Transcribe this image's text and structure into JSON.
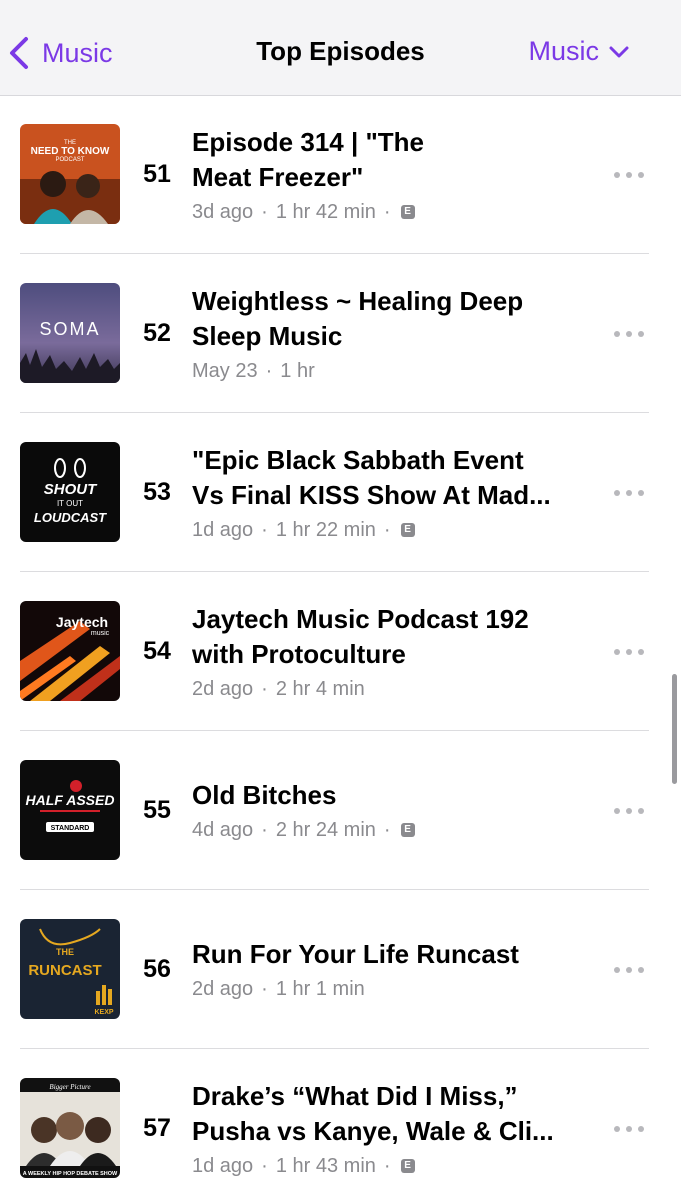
{
  "nav": {
    "back_label": "Music",
    "title": "Top Episodes",
    "menu_label": "Music"
  },
  "colors": {
    "accent": "#7b39e6",
    "secondary_text": "#8a8a8e"
  },
  "episodes": [
    {
      "rank": "51",
      "title_line1": "Episode 314 | \"The",
      "title_line2": "Meat Freezer\"",
      "age": "3d ago",
      "duration": "1 hr 42 min",
      "explicit": "E",
      "art_text_1": "THE",
      "art_text_2": "NEED TO KNOW",
      "art_text_3": "PODCAST"
    },
    {
      "rank": "52",
      "title_line1": "Weightless ~ Healing Deep",
      "title_line2": "Sleep Music",
      "age": "May 23",
      "duration": "1 hr",
      "art_text_1": "SOMA"
    },
    {
      "rank": "53",
      "title_line1": "\"Epic Black Sabbath Event",
      "title_line2": "Vs Final KISS Show At Mad...",
      "age": "1d ago",
      "duration": "1 hr 22 min",
      "explicit": "E",
      "art_text_1": "SHOUT",
      "art_text_2": "IT OUT",
      "art_text_3": "LOUDCAST"
    },
    {
      "rank": "54",
      "title_line1": "Jaytech Music Podcast 192",
      "title_line2": "with Protoculture",
      "age": "2d ago",
      "duration": "2 hr 4 min",
      "art_text_1": "Jaytech",
      "art_text_2": "music"
    },
    {
      "rank": "55",
      "title_line1": "Old Bitches",
      "age": "4d ago",
      "duration": "2 hr 24 min",
      "explicit": "E",
      "art_text_1": "HALF ASSED",
      "art_text_2": "STANDARD"
    },
    {
      "rank": "56",
      "title_line1": "Run For Your Life Runcast",
      "age": "2d ago",
      "duration": "1 hr 1 min",
      "art_text_1": "THE",
      "art_text_2": "RUNCAST",
      "art_text_3": "KEXP"
    },
    {
      "rank": "57",
      "title_line1": "Drake’s “What Did I Miss,”",
      "title_line2": "Pusha vs Kanye, Wale & Cli...",
      "age": "1d ago",
      "duration": "1 hr 43 min",
      "explicit": "E",
      "art_text_1": "Bigger Picture",
      "art_text_2": "A WEEKLY HIP HOP DEBATE SHOW"
    }
  ]
}
